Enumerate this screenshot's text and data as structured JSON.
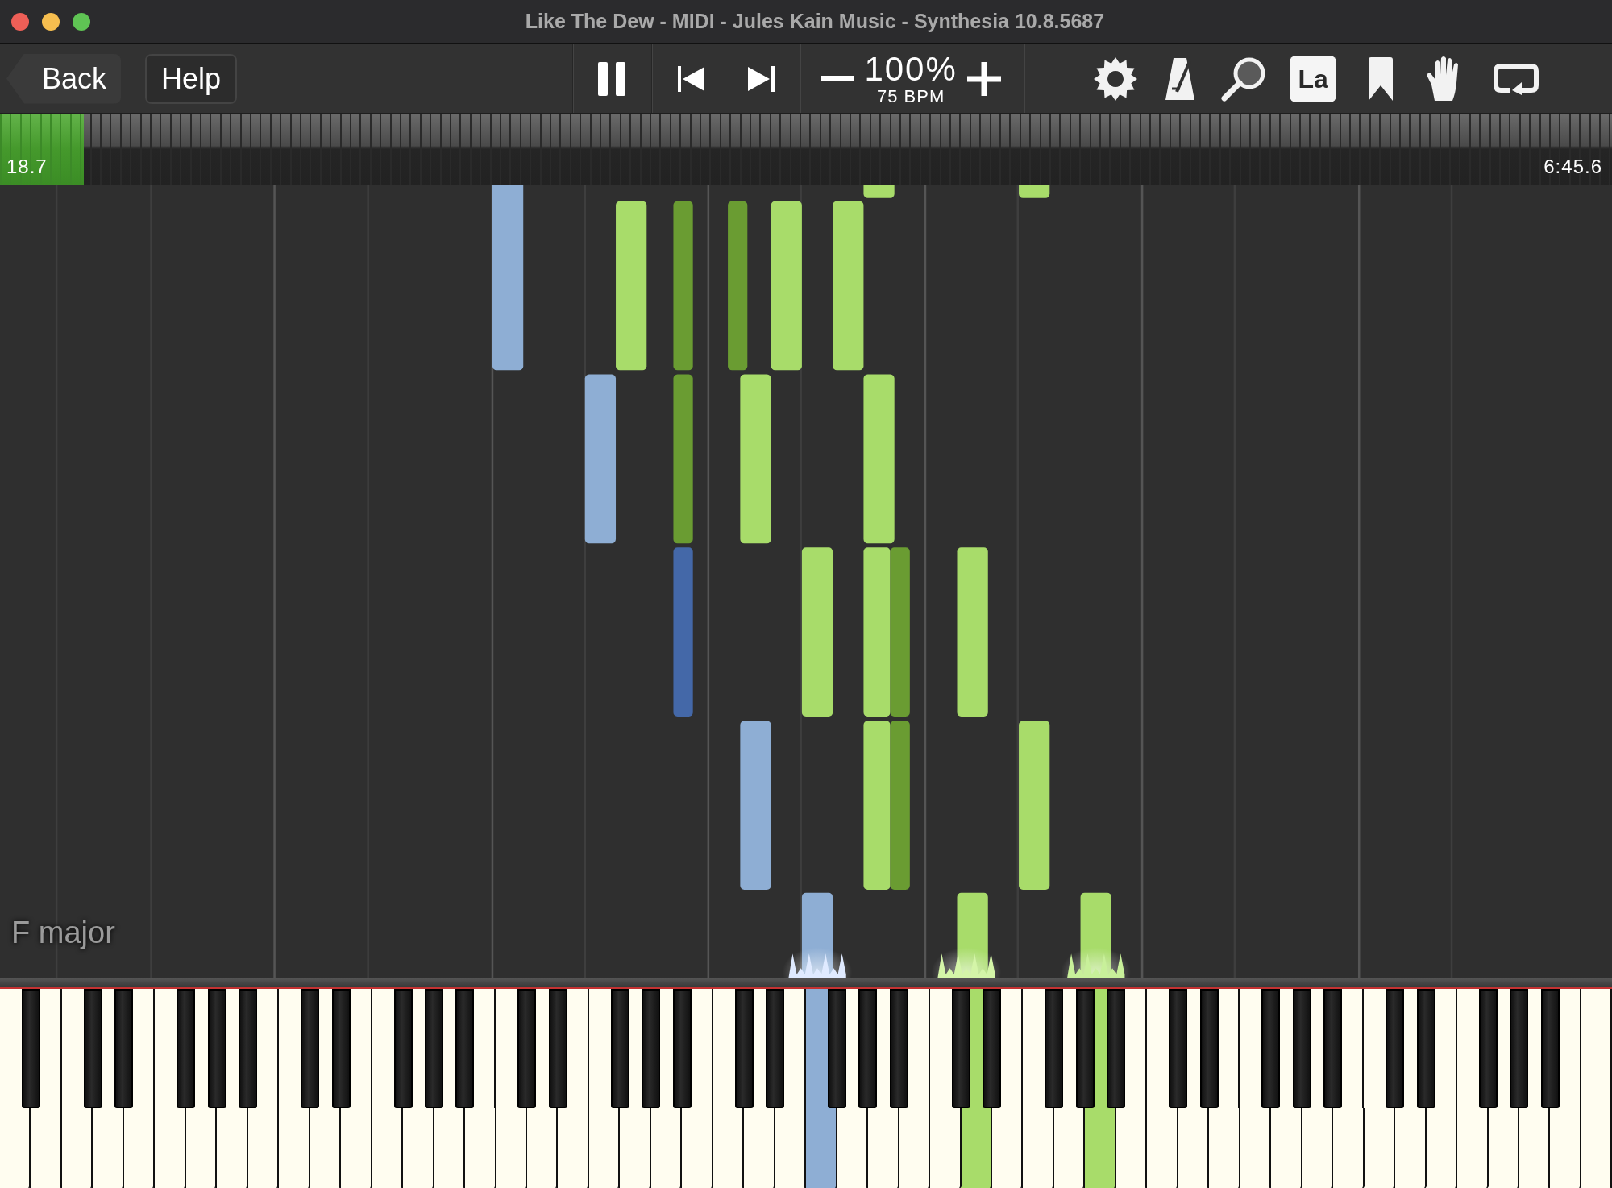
{
  "window": {
    "title": "Like The Dew - MIDI - Jules Kain Music - Synthesia 10.8.5687"
  },
  "toolbar": {
    "back": "Back",
    "help": "Help",
    "playing": true,
    "speed": "100%",
    "tempo": "75 BPM",
    "toggles": [
      {
        "kind": "settings",
        "on": false
      },
      {
        "kind": "metronome",
        "on": false
      },
      {
        "kind": "zoom",
        "on": false
      },
      {
        "kind": "labels",
        "label": "La",
        "on": true
      },
      {
        "kind": "bookmark",
        "on": false
      },
      {
        "kind": "hand",
        "on": false
      },
      {
        "kind": "loop",
        "on": false
      }
    ]
  },
  "timeline": {
    "level": 0.052,
    "elapsed": "18.7",
    "total": "6:45.6"
  },
  "key_signature": "F major",
  "piano": {
    "white_keys": [
      {
        "pressed": false
      },
      {
        "pressed": false
      },
      {
        "pressed": false
      },
      {
        "pressed": false
      },
      {
        "pressed": false
      },
      {
        "pressed": false
      },
      {
        "pressed": false
      },
      {
        "pressed": false
      },
      {
        "pressed": false
      },
      {
        "pressed": false
      },
      {
        "pressed": false
      },
      {
        "pressed": false
      },
      {
        "pressed": false
      },
      {
        "pressed": false
      },
      {
        "pressed": false
      },
      {
        "pressed": false
      },
      {
        "pressed": false
      },
      {
        "pressed": false
      },
      {
        "pressed": false
      },
      {
        "pressed": false
      },
      {
        "pressed": false
      },
      {
        "pressed": false
      },
      {
        "pressed": false
      },
      {
        "pressed": false
      },
      {
        "pressed": false
      },
      {
        "pressed": false
      },
      {
        "pressed": true,
        "color": "#8eaed4"
      },
      {
        "pressed": false
      },
      {
        "pressed": false
      },
      {
        "pressed": false
      },
      {
        "pressed": false
      },
      {
        "pressed": true,
        "color": "#a8dc6a"
      },
      {
        "pressed": false
      },
      {
        "pressed": false
      },
      {
        "pressed": false
      },
      {
        "pressed": true,
        "color": "#a8dc6a"
      },
      {
        "pressed": false
      },
      {
        "pressed": false
      },
      {
        "pressed": false
      },
      {
        "pressed": false
      },
      {
        "pressed": false
      },
      {
        "pressed": false
      },
      {
        "pressed": false
      },
      {
        "pressed": false
      },
      {
        "pressed": false
      },
      {
        "pressed": false
      },
      {
        "pressed": false
      },
      {
        "pressed": false
      },
      {
        "pressed": false
      },
      {
        "pressed": false
      },
      {
        "pressed": false
      },
      {
        "pressed": false
      }
    ]
  }
}
